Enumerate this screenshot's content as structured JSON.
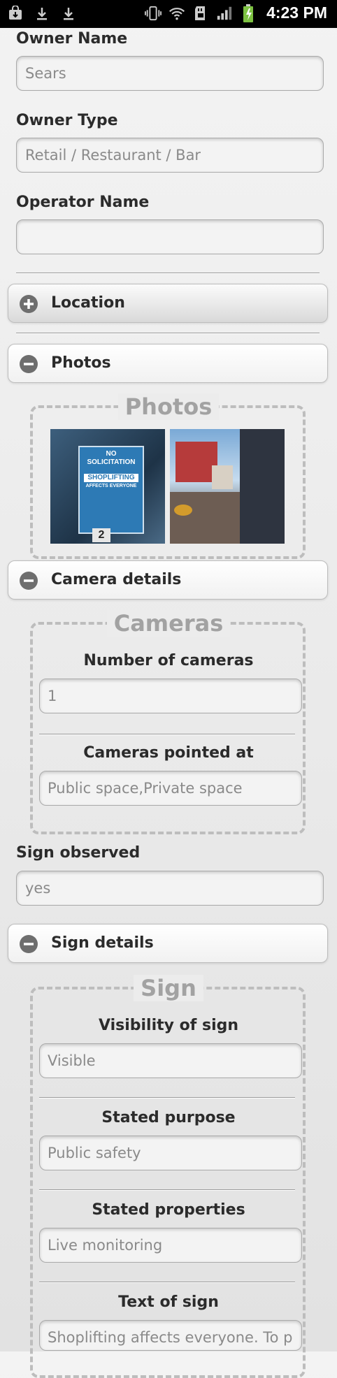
{
  "status_bar": {
    "time": "4:23 PM",
    "left_icons": [
      "bag-download-icon",
      "download-icon",
      "download-icon"
    ],
    "right_icons": [
      "vibrate-icon",
      "wifi-icon",
      "sd-card-icon",
      "signal-icon",
      "battery-charging-icon"
    ]
  },
  "form": {
    "owner_name": {
      "label": "Owner Name",
      "value": "Sears"
    },
    "owner_type": {
      "label": "Owner Type",
      "value": "Retail / Restaurant / Bar"
    },
    "operator_name": {
      "label": "Operator Name",
      "value": ""
    },
    "sign_observed": {
      "label": "Sign observed",
      "value": "yes"
    }
  },
  "sections": {
    "location": {
      "title": "Location",
      "state": "collapsed"
    },
    "photos": {
      "title": "Photos",
      "state": "expanded",
      "legend": "Photos"
    },
    "camera_details": {
      "title": "Camera details",
      "state": "expanded",
      "legend": "Cameras"
    },
    "sign_details": {
      "title": "Sign details",
      "state": "expanded",
      "legend": "Sign"
    }
  },
  "photos": [
    {
      "alt": "No solicitation sign photo",
      "sign_lines": [
        "NO",
        "SOLICITATION",
        "SHOPLIFTING",
        "AFFECTS EVERYONE"
      ],
      "number": "2"
    },
    {
      "alt": "Storefront street photo"
    }
  ],
  "cameras": {
    "number": {
      "label": "Number of cameras",
      "value": "1"
    },
    "pointed_at": {
      "label": "Cameras pointed at",
      "value": "Public space,Private space"
    }
  },
  "sign": {
    "visibility": {
      "label": "Visibility of sign",
      "value": "Visible"
    },
    "purpose": {
      "label": "Stated purpose",
      "value": "Public safety"
    },
    "properties": {
      "label": "Stated properties",
      "value": "Live monitoring"
    },
    "text": {
      "label": "Text of sign",
      "value": "Shoplifting affects everyone. To p"
    }
  },
  "colors": {
    "status_bar": "#000000",
    "background": "#ececec",
    "icon_gray": "#6e6e6e",
    "legend_gray": "#a2a2a2"
  }
}
